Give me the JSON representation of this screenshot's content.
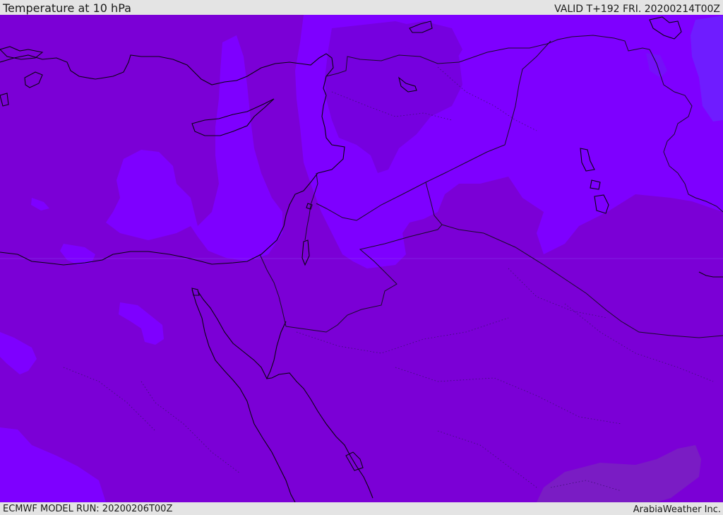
{
  "header": {
    "title": "Temperature at 10 hPa",
    "valid": "VALID T+192 FRI. 20200214T00Z"
  },
  "footer": {
    "model_run": "ECMWF MODEL RUN: 20200206T00Z",
    "credit": "ArabiaWeather Inc."
  },
  "map": {
    "colors": {
      "base_purple": "#7b00d6",
      "light_violet": "#7e00ff",
      "pale_violet": "#7511f5",
      "blue_violet": "#6f1cff",
      "dark_patch": "#7a1cc4",
      "border_line": "#1a0a2a",
      "coast_line": "#0a0410"
    }
  }
}
